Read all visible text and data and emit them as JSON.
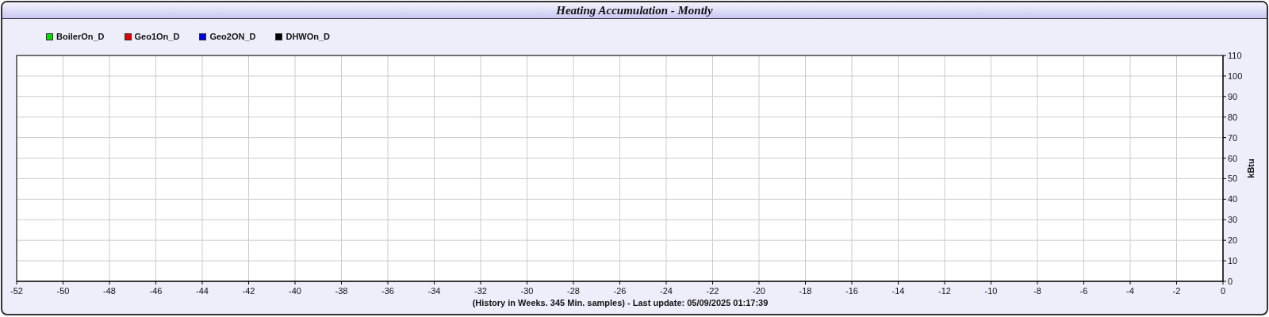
{
  "panel": {
    "title": "Heating Accumulation - Montly",
    "chart_data": {
      "type": "line",
      "xlabel": "(History in Weeks. 345 Min. samples) - Last update: 05/09/2025 01:17:39",
      "ylabel": "kBtu",
      "series": [
        {
          "name": "BoilerOn_D",
          "color": "#00dd00",
          "values": [
            null,
            null,
            null,
            null,
            null,
            null,
            null,
            null,
            null,
            null,
            null,
            null,
            null,
            null,
            null,
            null,
            null,
            null,
            null,
            null,
            null,
            null,
            null,
            null,
            null,
            null,
            null
          ]
        },
        {
          "name": "Geo1On_D",
          "color": "#dd0000",
          "values": [
            null,
            null,
            null,
            null,
            null,
            null,
            null,
            null,
            null,
            null,
            null,
            null,
            null,
            null,
            null,
            null,
            null,
            null,
            null,
            null,
            null,
            null,
            null,
            null,
            null,
            null,
            null
          ]
        },
        {
          "name": "Geo2ON_D",
          "color": "#0000dd",
          "values": [
            null,
            null,
            null,
            null,
            null,
            null,
            null,
            null,
            null,
            null,
            null,
            null,
            null,
            null,
            null,
            null,
            null,
            null,
            null,
            null,
            null,
            null,
            null,
            null,
            null,
            null,
            null
          ]
        },
        {
          "name": "DHWOn_D",
          "color": "#000000",
          "values": [
            null,
            null,
            null,
            null,
            null,
            null,
            null,
            null,
            null,
            null,
            null,
            null,
            null,
            null,
            null,
            null,
            null,
            null,
            null,
            null,
            null,
            null,
            null,
            null,
            null,
            null,
            null
          ]
        }
      ],
      "categories": [
        "-52",
        "-50",
        "-48",
        "-46",
        "-44",
        "-42",
        "-40",
        "-38",
        "-36",
        "-34",
        "-32",
        "-30",
        "-28",
        "-26",
        "-24",
        "-22",
        "-20",
        "-18",
        "-16",
        "-14",
        "-12",
        "-10",
        "-8",
        "-6",
        "-4",
        "-2",
        "0"
      ],
      "ylim": [
        0,
        110
      ],
      "grid": true,
      "yticks": [
        0,
        10,
        20,
        30,
        40,
        50,
        60,
        70,
        80,
        90,
        100,
        110
      ]
    }
  }
}
